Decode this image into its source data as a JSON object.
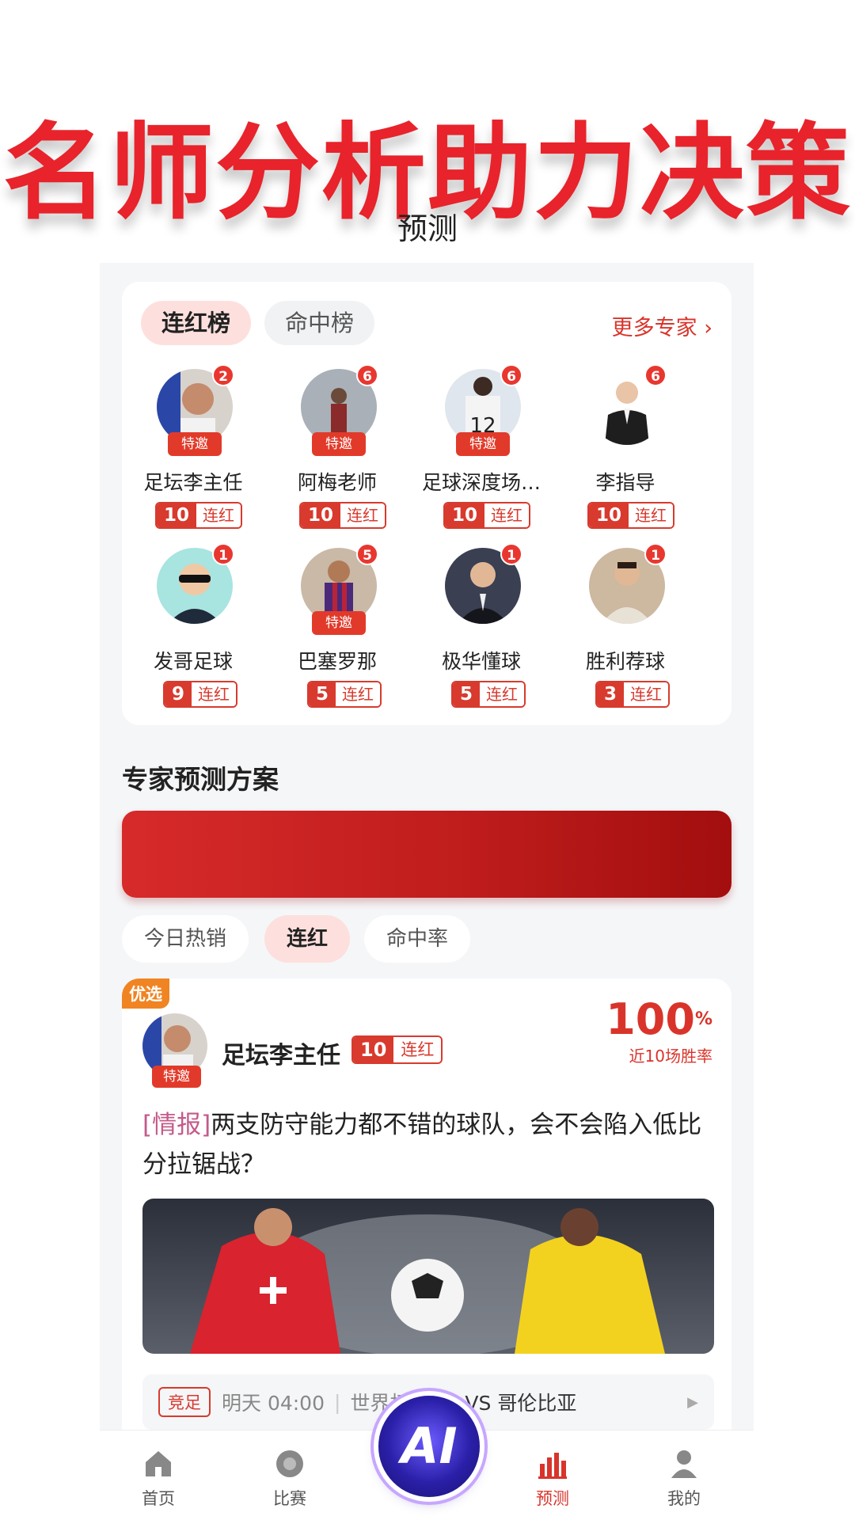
{
  "promo": {
    "headline": "名师分析助力决策"
  },
  "header": {
    "title": "预测"
  },
  "leaderboard": {
    "tabs": [
      {
        "label": "连红榜",
        "active": true
      },
      {
        "label": "命中榜",
        "active": false
      }
    ],
    "more_label": "更多专家",
    "streak_suffix": "连红",
    "invite_label": "特邀",
    "experts": [
      {
        "name": "足坛李主任",
        "badge": "2",
        "invited": true,
        "streak": "10"
      },
      {
        "name": "阿梅老师",
        "badge": "6",
        "invited": true,
        "streak": "10"
      },
      {
        "name": "足球深度场…",
        "badge": "6",
        "invited": true,
        "streak": "10"
      },
      {
        "name": "李指导",
        "badge": "6",
        "invited": false,
        "streak": "10"
      },
      {
        "name": "发哥足球",
        "badge": "1",
        "invited": false,
        "streak": "9"
      },
      {
        "name": "巴塞罗那",
        "badge": "5",
        "invited": true,
        "streak": "5"
      },
      {
        "name": "极华懂球",
        "badge": "1",
        "invited": false,
        "streak": "5"
      },
      {
        "name": "胜利荐球",
        "badge": "1",
        "invited": false,
        "streak": "3"
      }
    ]
  },
  "plans": {
    "section_title": "专家预测方案",
    "filters": [
      {
        "label": "今日热销",
        "active": false
      },
      {
        "label": "连红",
        "active": true
      },
      {
        "label": "命中率",
        "active": false
      }
    ]
  },
  "prediction": {
    "pick_tag": "优选",
    "invite_label": "特邀",
    "expert_name": "足坛李主任",
    "streak": "10",
    "streak_suffix": "连红",
    "win_rate": "100",
    "win_rate_unit": "%",
    "win_rate_label": "近10场胜率",
    "keyword": "[情报]",
    "text": "两支防守能力都不错的球队，会不会陷入低比分拉锯战？",
    "match": {
      "competition_type": "竞足",
      "time": "明天 04:00",
      "league": "世界杯",
      "teams": "瑞士 VS 哥伦比亚"
    }
  },
  "nav": {
    "items": [
      {
        "label": "首页",
        "icon": "home-icon",
        "active": false
      },
      {
        "label": "比赛",
        "icon": "ball-icon",
        "active": false
      },
      {
        "label": "预测",
        "icon": "bar-chart-icon",
        "active": true
      },
      {
        "label": "我的",
        "icon": "user-icon",
        "active": false
      }
    ],
    "ai_label": "AI"
  },
  "colors": {
    "accent": "#d9342b",
    "badge": "#e8372f",
    "banner": "#c01d1d",
    "pick_tag": "#f08422"
  }
}
